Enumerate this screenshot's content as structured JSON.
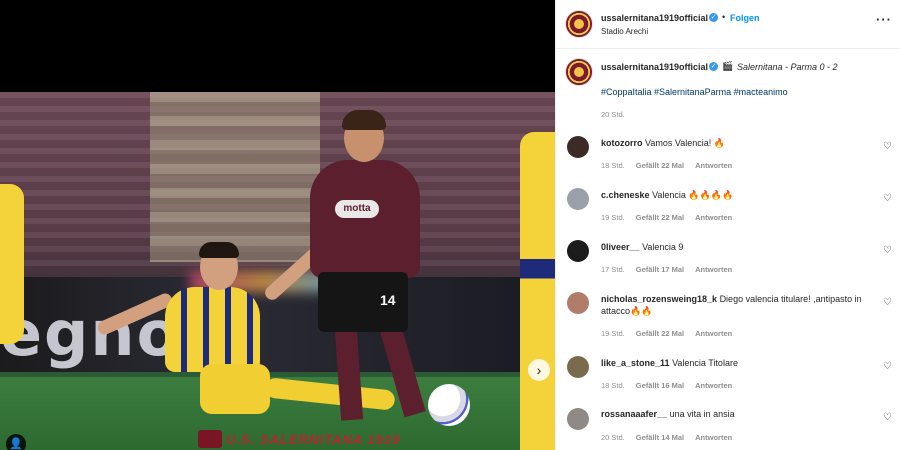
{
  "post": {
    "username": "ussalernitana1919official",
    "follow_label": "Folgen",
    "location": "Stadio Arechi",
    "more_icon": "ellipsis-icon",
    "caption": {
      "username": "ussalernitana1919official",
      "clapper": "🎬",
      "text": "Salernitana - Parma 0 - 2",
      "hashtags": "#CoppaItalia #SalernitanaParma #macteanimo",
      "time": "20 Std."
    }
  },
  "photo": {
    "board_text": "egno",
    "shirt_sponsor": "motta",
    "shirt_number": "14",
    "watermark": "U.S. SALERNITANA 1919",
    "next_arrow": "›",
    "user_tag_icon": "👤"
  },
  "comments": [
    {
      "user": "kotozorro",
      "text": "Vamos Valencia! 🔥",
      "time": "18 Std.",
      "likes": "Gefällt 22 Mal",
      "reply": "Antworten",
      "avatar_color": "#3b2a26"
    },
    {
      "user": "c.cheneske",
      "text": "Valencia 🔥🔥🔥🔥",
      "time": "19 Std.",
      "likes": "Gefällt 22 Mal",
      "reply": "Antworten",
      "avatar_color": "#9aa0a8"
    },
    {
      "user": "0liveer__",
      "text": "Valencia 9",
      "time": "17 Std.",
      "likes": "Gefällt 17 Mal",
      "reply": "Antworten",
      "avatar_color": "#1c1c1c"
    },
    {
      "user": "nicholas_rozensweing18_k",
      "text": "Diego valencia titulare! ,antipasto in",
      "text2": "attacco🔥🔥",
      "time": "19 Std.",
      "likes": "Gefällt 22 Mal",
      "reply": "Antworten",
      "avatar_color": "#b07d6a"
    },
    {
      "user": "like_a_stone_11",
      "text": "Valencia Titolare",
      "time": "18 Std.",
      "likes": "Gefällt 16 Mal",
      "reply": "Antworten",
      "avatar_color": "#7a6b4f"
    },
    {
      "user": "rossanaaafer__",
      "text": "una vita in ansia",
      "time": "20 Std.",
      "likes": "Gefällt 14 Mal",
      "reply": "Antworten",
      "avatar_color": "#8f8a85"
    }
  ],
  "colors": {
    "accent": "#0095f6",
    "hashtag": "#00376b",
    "club": "#7b1b2b"
  }
}
